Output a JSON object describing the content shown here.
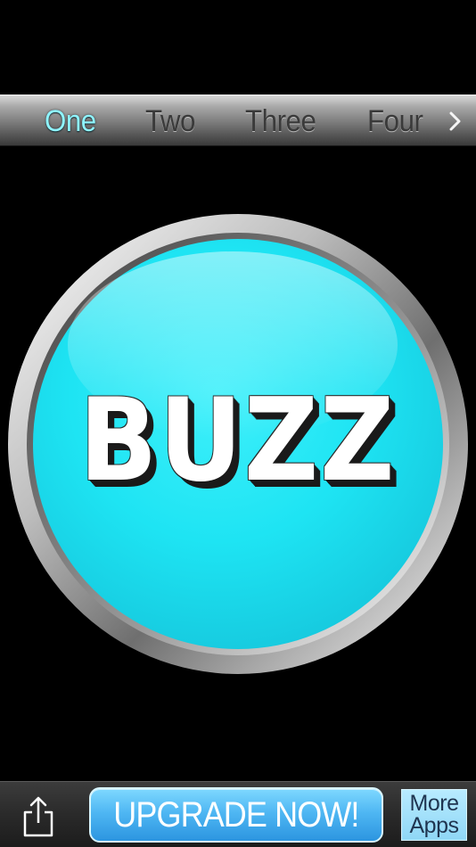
{
  "tabs": [
    {
      "label": "One",
      "active": true
    },
    {
      "label": "Two",
      "active": false
    },
    {
      "label": "Three",
      "active": false
    },
    {
      "label": "Four",
      "active": false
    }
  ],
  "tab_next_icon": "chevron-right-icon",
  "buzzer": {
    "label": "BUZZ",
    "color": "#1ce6f5",
    "rim_color": "#c8c8c8"
  },
  "bottom_bar": {
    "share_icon": "share-icon",
    "upgrade_label": "UPGRADE NOW!",
    "more_apps_line1": "More",
    "more_apps_line2": "Apps"
  },
  "colors": {
    "background": "#000000",
    "active_tab": "#8ff4ff",
    "inactive_tab": "#3a3a3a",
    "upgrade_button": "#4fb7f3"
  }
}
